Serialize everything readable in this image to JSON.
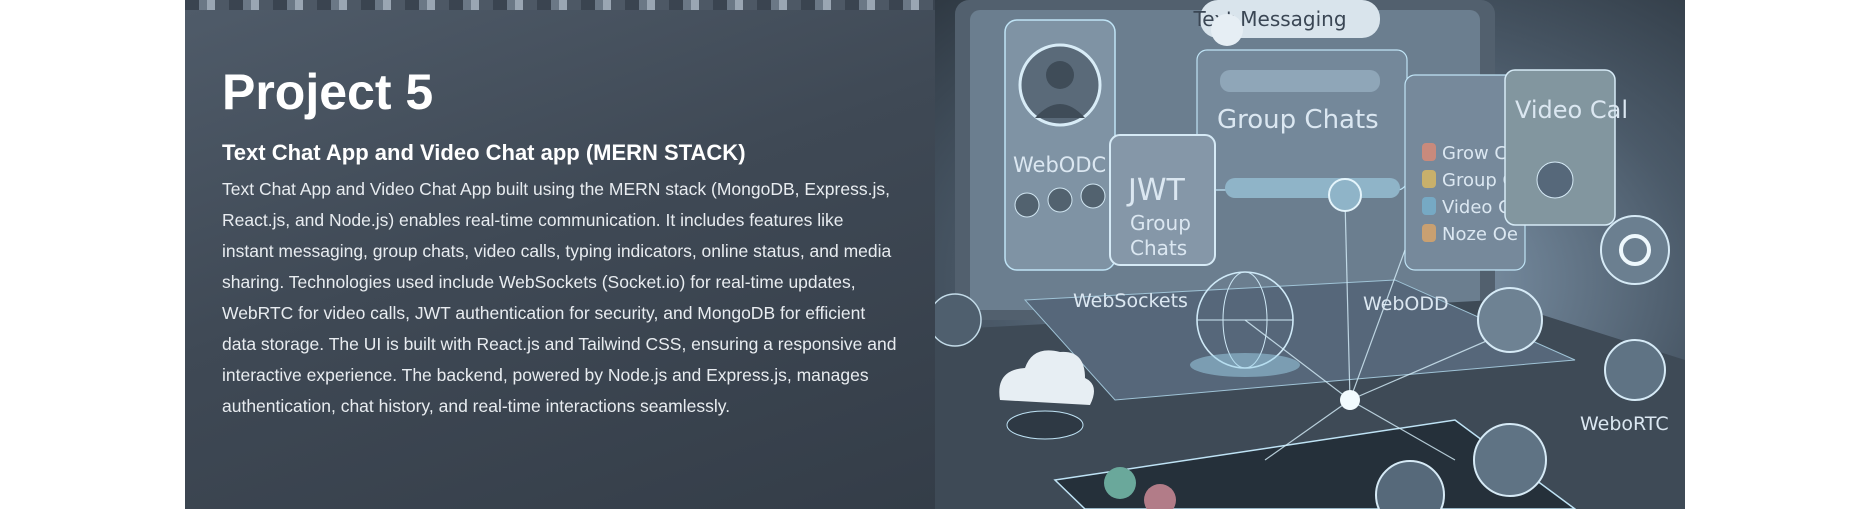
{
  "project": {
    "title": "Project 5",
    "subtitle": "Text Chat App and Video Chat app (MERN STACK)",
    "description": "Text Chat App and Video Chat App built using the MERN stack (MongoDB, Express.js, React.js, and Node.js) enables real-time communication. It includes features like instant messaging, group chats, video calls, typing indicators, online status, and media sharing. Technologies used include WebSockets (Socket.io) for real-time updates, WebRTC for video calls, JWT authentication for security, and MongoDB for efficient data storage. The UI is built with React.js and Tailwind CSS, ensuring a responsive and interactive experience. The backend, powered by Node.js and Express.js, manages authentication, chat history, and real-time interactions seamlessly."
  },
  "illustration": {
    "labels": {
      "text_messaging": "Text Messaging",
      "group_chats": "Group Chats",
      "video_call_header": "Video Cal",
      "jwt": "JWT",
      "jwt_group": "Group",
      "jwt_chats": "Chats",
      "webodc": "WebODC",
      "websockets": "WebSockets",
      "webodd": "WebODD",
      "webortc": "WeboRTC",
      "list_item_1": "Grow Chat",
      "list_item_2": "Group Calt",
      "list_item_3": "Video Call",
      "list_item_4": "Noze Oe"
    },
    "colors": {
      "glow": "#bfe3f5",
      "panel": "#5d6f80",
      "screen": "#7d91a3"
    }
  }
}
